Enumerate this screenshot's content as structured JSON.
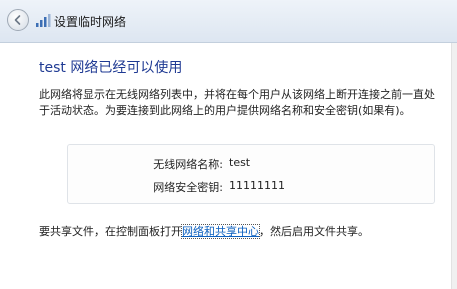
{
  "window": {
    "title": "设置临时网络",
    "back_icon": "back-arrow-icon",
    "app_icon": "network-icon"
  },
  "main": {
    "heading": "test 网络已经可以使用",
    "description": "此网络将显示在无线网络列表中，并将在每个用户从该网络上断开连接之前一直处于活动状态。为要连接到此网络上的用户提供网络名称和安全密钥(如果有)。"
  },
  "network_info": {
    "name_label": "无线网络名称:",
    "name_value": "test",
    "key_label": "网络安全密钥:",
    "key_value": "11111111"
  },
  "sharing": {
    "prefix": "要共享文件，在控制面板打开",
    "link_text": "网络和共享中心",
    "suffix": "，然后启用文件共享。"
  },
  "colors": {
    "heading": "#1f3a93",
    "link": "#0b5fbf"
  }
}
